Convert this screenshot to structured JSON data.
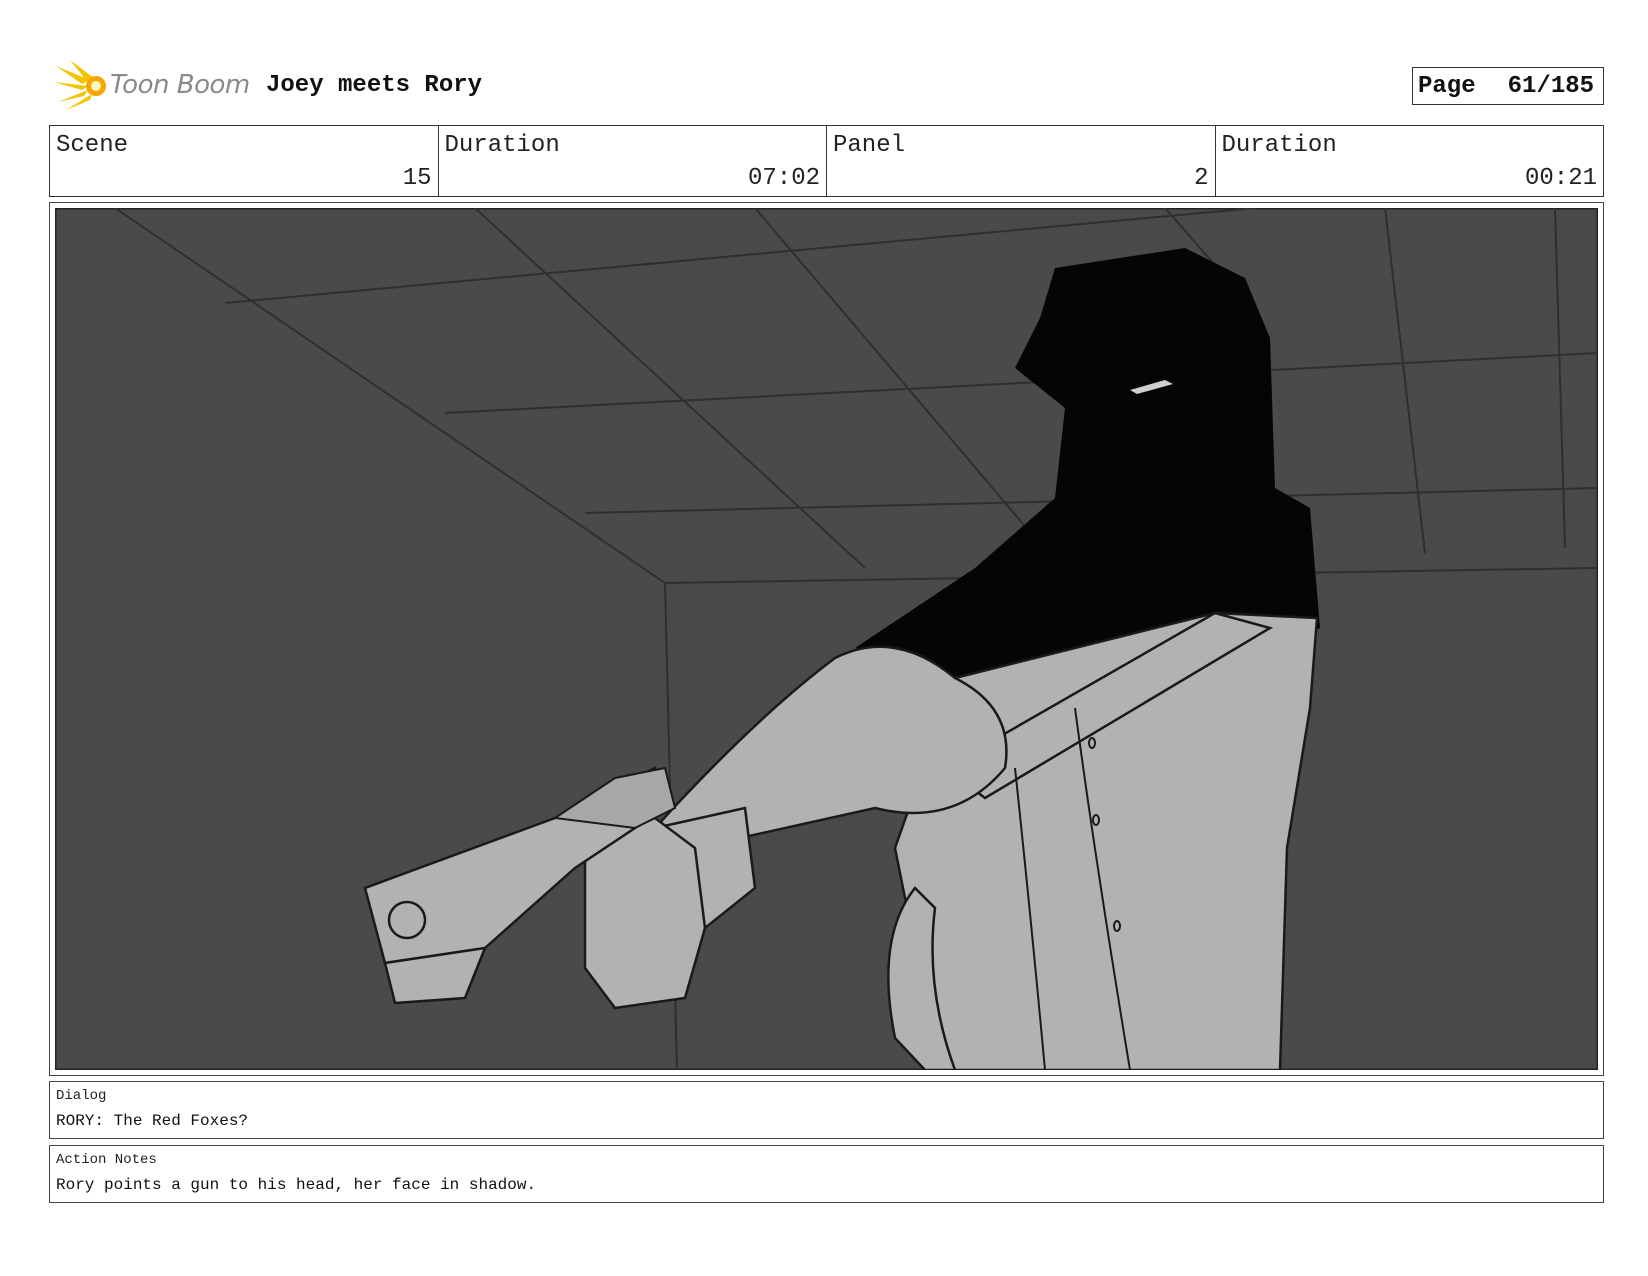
{
  "header": {
    "logo_text": "Toon Boom",
    "project_title": "Joey meets Rory",
    "page_label": "Page",
    "page_number": "61/185"
  },
  "info": {
    "scene_label": "Scene",
    "scene_value": "15",
    "scene_duration_label": "Duration",
    "scene_duration_value": "07:02",
    "panel_label": "Panel",
    "panel_value": "2",
    "panel_duration_label": "Duration",
    "panel_duration_value": "00:21"
  },
  "dialog": {
    "label": "Dialog",
    "text": "RORY: The Red Foxes?"
  },
  "action_notes": {
    "label": "Action Notes",
    "text": "Rory points a gun to his head, her face in shadow."
  },
  "colors": {
    "background": "#4a4a4a",
    "figure_light": "#b2b2b2",
    "shadow": "#050505",
    "logo_accent": "#f5c400"
  }
}
